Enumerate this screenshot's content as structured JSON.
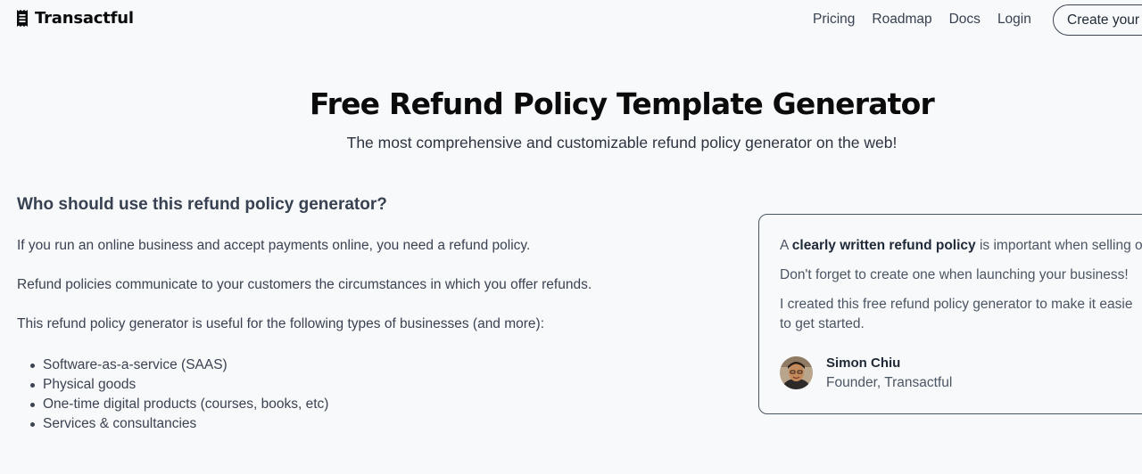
{
  "header": {
    "brand": "Transactful",
    "nav": [
      "Pricing",
      "Roadmap",
      "Docs",
      "Login"
    ],
    "cta": "Create your"
  },
  "hero": {
    "title": "Free Refund Policy Template Generator",
    "subtitle": "The most comprehensive and customizable refund policy generator on the web!"
  },
  "about": {
    "heading": "Who should use this refund policy generator?",
    "p1": "If you run an online business and accept payments online, you need a refund policy.",
    "p2": "Refund policies communicate to your customers the circumstances in which you offer refunds.",
    "p3": "This refund policy generator is useful for the following types of businesses (and more):",
    "list": [
      "Software-as-a-service (SAAS)",
      "Physical goods",
      "One-time digital products (courses, books, etc)",
      "Services & consultancies"
    ]
  },
  "testimonial": {
    "line1_pre": "A ",
    "line1_bold": "clearly written refund policy",
    "line1_post": " is important when selling o",
    "line2": "Don't forget to create one when launching your business!",
    "line3a": "I created this free refund policy generator to make it easie",
    "line3b": "to get started.",
    "author_name": "Simon Chiu",
    "author_role": "Founder, Transactful"
  },
  "colors": {
    "background": "#f8f9fb",
    "heading": "#0b0b0b",
    "body_text": "#3b4252",
    "border": "#4b5563"
  },
  "icons": {
    "brand": "receipt-icon",
    "avatar": "user-avatar"
  }
}
